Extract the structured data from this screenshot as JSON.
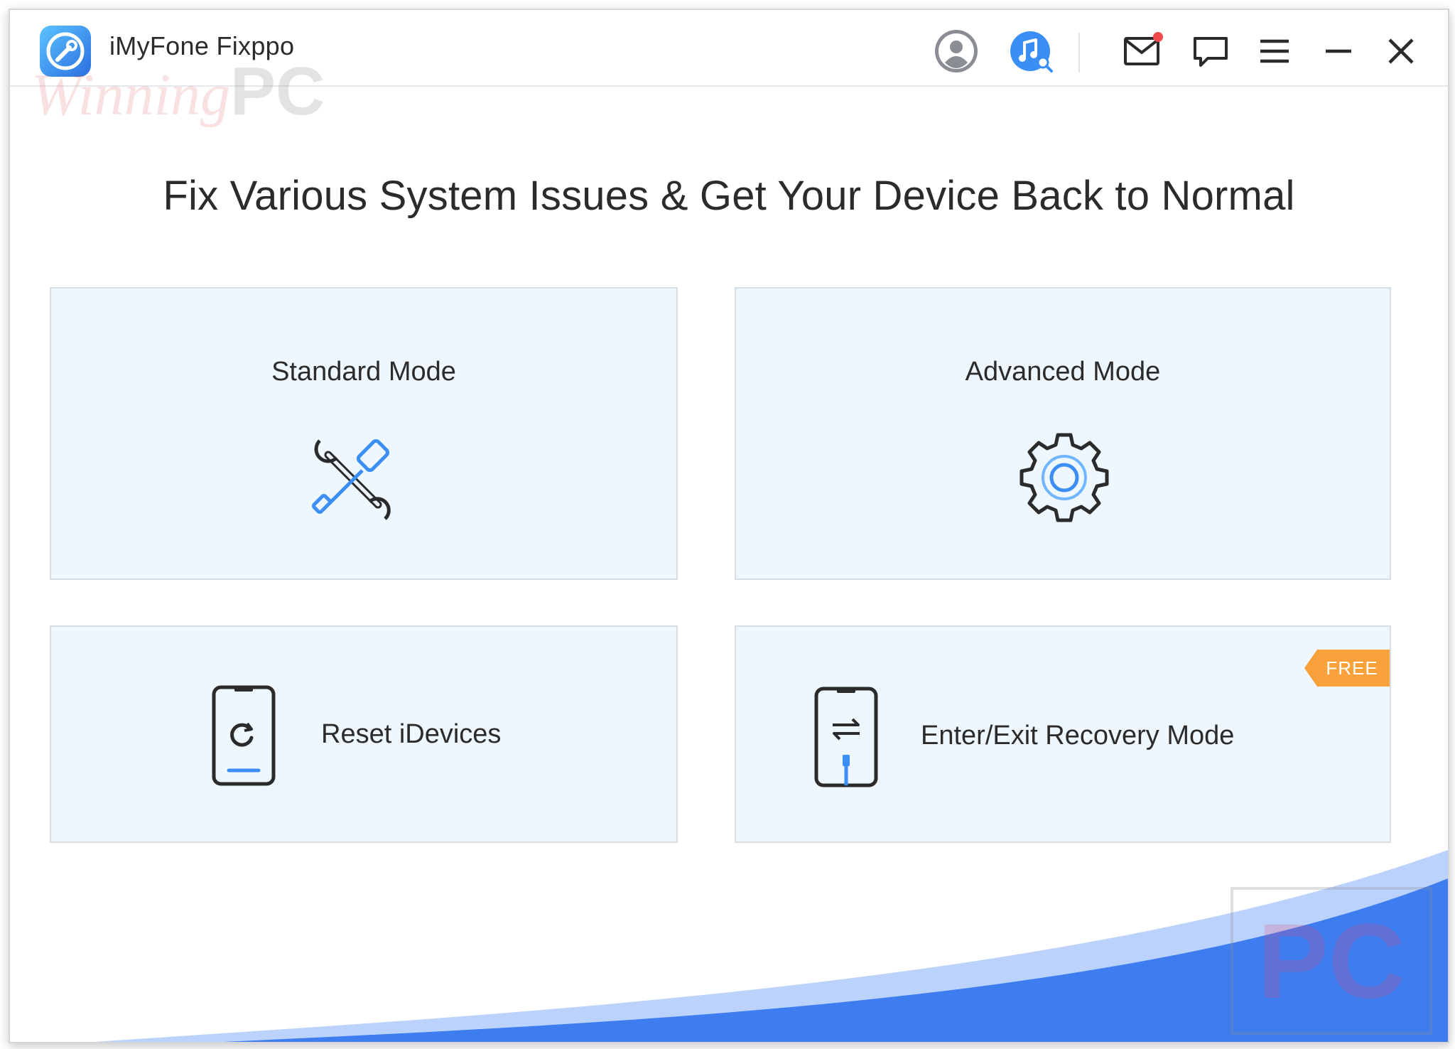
{
  "app": {
    "title": "iMyFone Fixppo",
    "watermark_script": "Winning",
    "watermark_pc": "PC",
    "brand_color": "#3a8ef6"
  },
  "titlebar": {
    "icons": [
      "user-account-icon",
      "music-search-icon",
      "mail-icon",
      "feedback-icon",
      "menu-icon",
      "minimize-icon",
      "close-icon"
    ],
    "notification_dot_color": "#f04a4a"
  },
  "main": {
    "headline": "Fix Various System Issues & Get Your Device Back to Normal",
    "cards": {
      "standard": {
        "title": "Standard Mode",
        "icon": "wrench-screwdriver-icon"
      },
      "advanced": {
        "title": "Advanced Mode",
        "icon": "gear-icon"
      },
      "reset": {
        "label": "Reset iDevices",
        "icon": "phone-reset-icon"
      },
      "recovery": {
        "label": "Enter/Exit Recovery Mode",
        "icon": "phone-recovery-icon",
        "badge": "FREE"
      }
    }
  },
  "footer": {
    "wave_color": "#3d7df0",
    "watermark_box_text": "PC"
  }
}
